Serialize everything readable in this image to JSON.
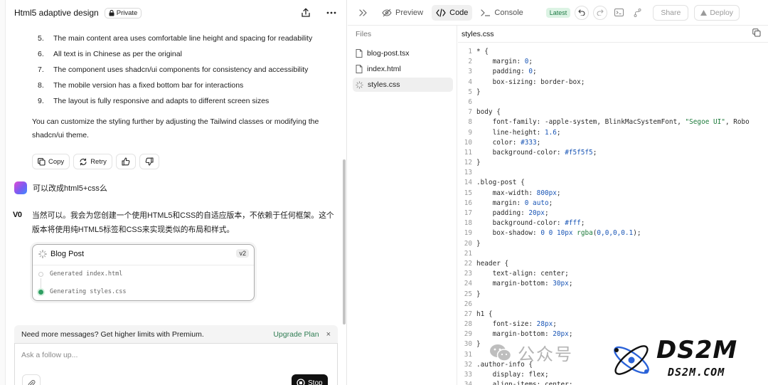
{
  "chat": {
    "title": "Html5 adaptive design",
    "private_label": "Private",
    "points": [
      {
        "num": "5.",
        "text": "The main content area uses comfortable line height and spacing for readability"
      },
      {
        "num": "6.",
        "text": "All text is in Chinese as per the original"
      },
      {
        "num": "7.",
        "text": "The component uses shadcn/ui components for consistency and accessibility"
      },
      {
        "num": "8.",
        "text": "The mobile version has a fixed bottom bar for interactions"
      },
      {
        "num": "9.",
        "text": "The layout is fully responsive and adapts to different screen sizes"
      }
    ],
    "closing": "You can customize the styling further by adjusting the Tailwind classes or modifying the shadcn/ui theme.",
    "actions": {
      "copy": "Copy",
      "retry": "Retry"
    },
    "user_message": "可以改成html5+css么",
    "bot_logo": "V0",
    "bot_message": "当然可以。我会为您创建一个使用HTML5和CSS的自适应版本，不依赖于任何框架。这个版本将使用纯HTML5标签和CSS来实现类似的布局和样式。",
    "generation": {
      "title": "Blog Post",
      "version": "v2",
      "steps": [
        {
          "text": "Generated index.html",
          "status": "done"
        },
        {
          "text": "Generating styles.css",
          "status": "active"
        }
      ]
    },
    "upgrade": {
      "text": "Need more messages? Get higher limits with Premium.",
      "link": "Upgrade Plan",
      "close": "×"
    },
    "composer": {
      "placeholder": "Ask a follow up...",
      "stop_label": "Stop"
    }
  },
  "editor": {
    "tabs": [
      {
        "label": "Preview",
        "icon": "eye-off-icon"
      },
      {
        "label": "Code",
        "icon": "code-icon"
      },
      {
        "label": "Console",
        "icon": "terminal-icon"
      }
    ],
    "latest_badge": "Latest",
    "share_label": "Share",
    "deploy_label": "Deploy",
    "files_heading": "Files",
    "files": [
      {
        "name": "blog-post.tsx",
        "active": false
      },
      {
        "name": "index.html",
        "active": false
      },
      {
        "name": "styles.css",
        "active": true
      }
    ],
    "filename": "styles.css",
    "code_lines": [
      {
        "n": "1",
        "t": "* {"
      },
      {
        "n": "2",
        "t": "    margin: 0;"
      },
      {
        "n": "3",
        "t": "    padding: 0;"
      },
      {
        "n": "4",
        "t": "    box-sizing: border-box;"
      },
      {
        "n": "5",
        "t": "}"
      },
      {
        "n": "6",
        "t": ""
      },
      {
        "n": "7",
        "t": "body {"
      },
      {
        "n": "8",
        "t": "    font-family: -apple-system, BlinkMacSystemFont, \"Segoe UI\", Robo"
      },
      {
        "n": "9",
        "t": "    line-height: 1.6;"
      },
      {
        "n": "10",
        "t": "    color: #333;"
      },
      {
        "n": "11",
        "t": "    background-color: #f5f5f5;"
      },
      {
        "n": "12",
        "t": "}"
      },
      {
        "n": "13",
        "t": ""
      },
      {
        "n": "14",
        "t": ".blog-post {"
      },
      {
        "n": "15",
        "t": "    max-width: 800px;"
      },
      {
        "n": "16",
        "t": "    margin: 0 auto;"
      },
      {
        "n": "17",
        "t": "    padding: 20px;"
      },
      {
        "n": "18",
        "t": "    background-color: #fff;"
      },
      {
        "n": "19",
        "t": "    box-shadow: 0 0 10px rgba(0,0,0,0.1);"
      },
      {
        "n": "20",
        "t": "}"
      },
      {
        "n": "21",
        "t": ""
      },
      {
        "n": "22",
        "t": "header {"
      },
      {
        "n": "23",
        "t": "    text-align: center;"
      },
      {
        "n": "24",
        "t": "    margin-bottom: 30px;"
      },
      {
        "n": "25",
        "t": "}"
      },
      {
        "n": "26",
        "t": ""
      },
      {
        "n": "27",
        "t": "h1 {"
      },
      {
        "n": "28",
        "t": "    font-size: 28px;"
      },
      {
        "n": "29",
        "t": "    margin-bottom: 20px;"
      },
      {
        "n": "30",
        "t": "}"
      },
      {
        "n": "31",
        "t": ""
      },
      {
        "n": "32",
        "t": ".author-info {"
      },
      {
        "n": "33",
        "t": "    display: flex;"
      },
      {
        "n": "34",
        "t": "    align-items: center;"
      }
    ]
  },
  "watermark": {
    "wechat_text": "公众号",
    "brand": "DS2M",
    "brand_url": "DS2M.COM"
  },
  "colors": {
    "accent_green": "#2f7d53",
    "latest_bg": "#dcf3e4",
    "step_active": "#2f9e62",
    "code_number": "#1a56b6",
    "code_string": "#1c7a3a"
  }
}
